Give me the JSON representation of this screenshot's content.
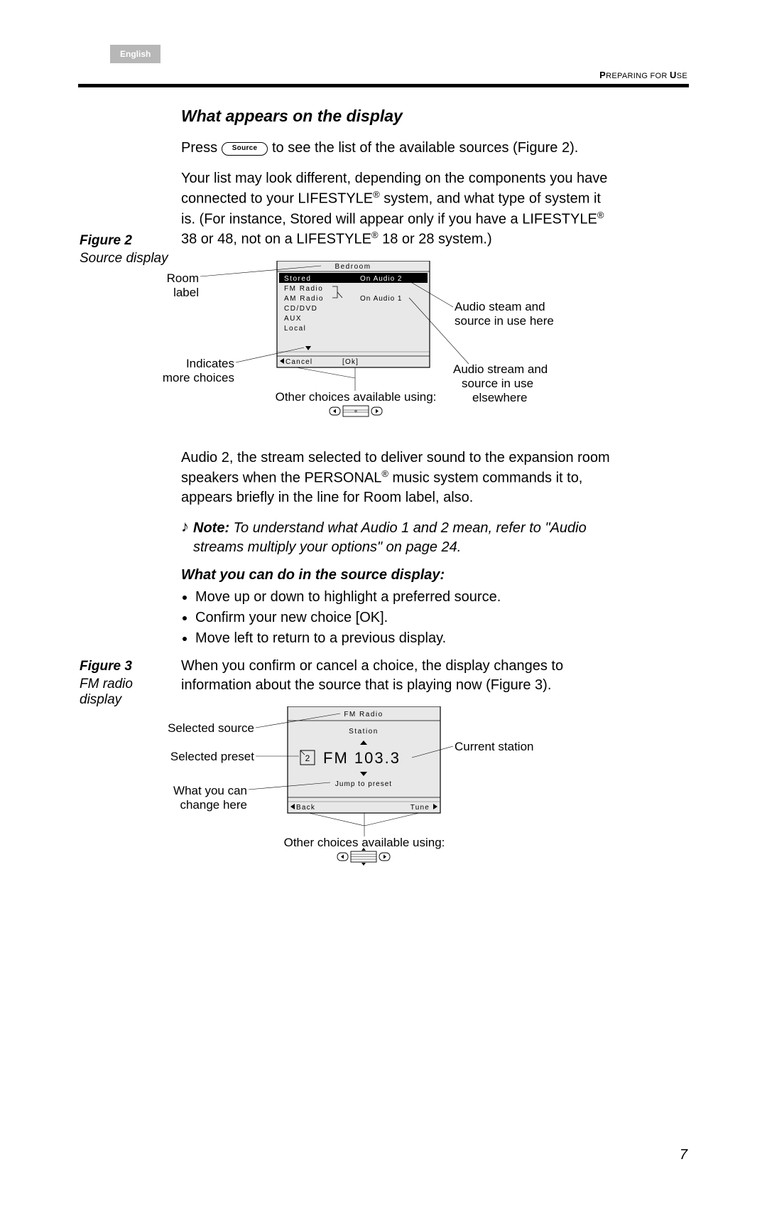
{
  "lang_tab": "English",
  "section_label_1": "P",
  "section_label_2": "REPARING FOR ",
  "section_label_3": "U",
  "section_label_4": "SE",
  "heading": "What appears on the display",
  "press_text_1": "Press",
  "press_text_2": "to see the list of the available sources (Figure 2).",
  "source_button_label": "Source",
  "para2_a": "Your list may look different, depending on the components you have connected to your LIFESTYLE",
  "para2_b": " system, and what type of system it is. (For instance, Stored will appear only if you have a LIFESTYLE",
  "para2_c": " 38 or 48, not on a LIFESTYLE",
  "para2_d": " 18 or 28 system.)",
  "fig2": {
    "label": "Figure 2",
    "caption": "Source display"
  },
  "fig2_callouts": {
    "room_label": "Room label",
    "indicates": "Indicates more choices",
    "other_choices": "Other choices available using:",
    "audio_here_1": "Audio steam and",
    "audio_here_2": "source in use here",
    "audio_elsewhere_1": "Audio stream and",
    "audio_elsewhere_2": "source in use",
    "audio_elsewhere_3": "elsewhere"
  },
  "fig2_display": {
    "room": "Bedroom",
    "items": [
      "Stored",
      "FM Radio",
      "AM Radio",
      "CD/DVD",
      "AUX",
      "Local"
    ],
    "on_audio_2": "On Audio 2",
    "on_audio_1": "On Audio 1",
    "cancel": "Cancel",
    "ok": "[Ok]"
  },
  "para3_a": "Audio 2, the stream selected to deliver sound to the expansion room speakers when the PERSONAL",
  "para3_b": " music system commands it to, appears briefly in the line for Room label, also.",
  "note_label": "Note:",
  "note_body": " To understand what Audio 1 and 2 mean, refer to \"Audio streams multiply your options\" on page 24.",
  "sub_heading": "What you can do in the source display:",
  "bullets": [
    "Move up or down to highlight a preferred source.",
    "Confirm your new choice [OK].",
    "Move left to return to a previous display."
  ],
  "para4": "When you confirm or cancel a choice, the display changes to information about the source that is playing now (Figure 3).",
  "fig3": {
    "label": "Figure 3",
    "caption": "FM radio display"
  },
  "fig3_callouts": {
    "selected_source": "Selected source",
    "selected_preset": "Selected preset",
    "what_change_1": "What you can",
    "what_change_2": "change here",
    "current_station": "Current station",
    "other_choices": "Other choices available using:"
  },
  "fig3_display": {
    "title": "FM Radio",
    "station": "Station",
    "preset": "2",
    "freq": "FM 103.3",
    "jump": "Jump to preset",
    "back": "Back",
    "tune": "Tune"
  },
  "page_number": "7"
}
